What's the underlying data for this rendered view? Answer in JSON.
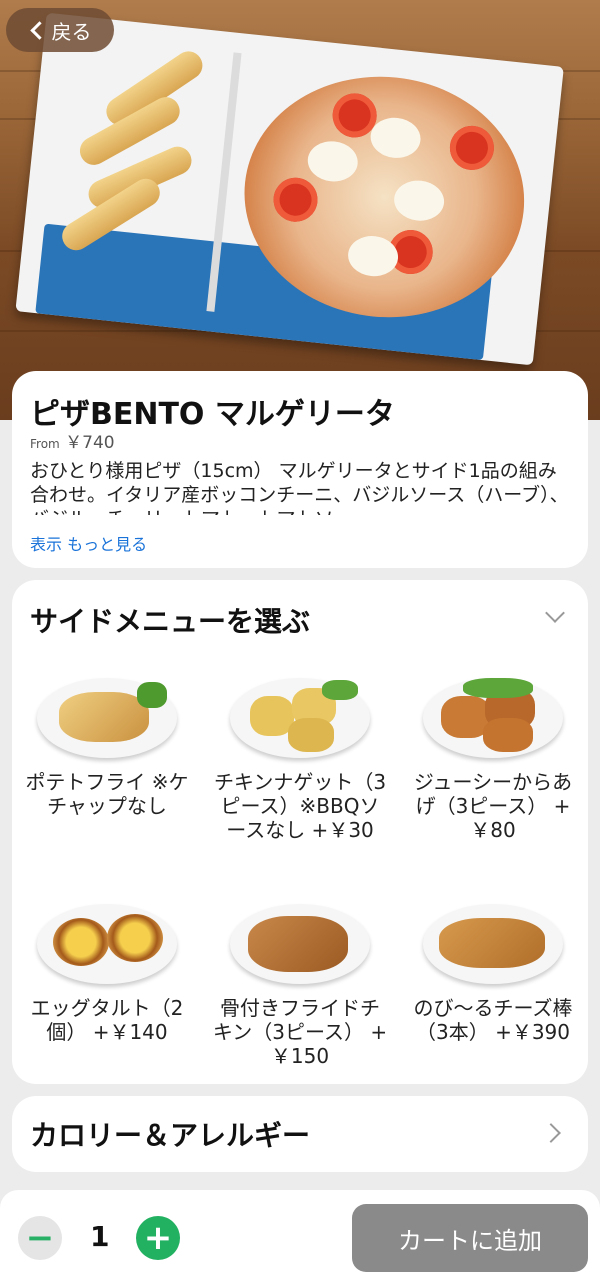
{
  "nav": {
    "back_label": "戻る"
  },
  "product": {
    "title": "ピザBENTO マルゲリータ",
    "price_prefix": "From",
    "price": "￥740",
    "description": "おひとり様用ピザ（15cm） マルゲリータとサイド1品の組み合わせ。イタリア産ボッコンチーニ、バジルソース（ハーブ）、バジル、チェリートマト、トマトソ",
    "show_more": "表示 もっと見る"
  },
  "side_menu": {
    "title": "サイドメニューを選ぶ",
    "items": [
      {
        "label": "ポテトフライ ※ケチャップなし",
        "icon": "potato-wedges"
      },
      {
        "label": "チキンナゲット（3ピース）※BBQソースなし +￥30",
        "icon": "chicken-nuggets"
      },
      {
        "label": "ジューシーからあげ（3ピース） +￥80",
        "icon": "karaage"
      },
      {
        "label": "エッグタルト（2個） +￥140",
        "icon": "egg-tart"
      },
      {
        "label": "骨付きフライドチキン（3ピース） +￥150",
        "icon": "fried-chicken"
      },
      {
        "label": "のび〜るチーズ棒（3本） +￥390",
        "icon": "cheese-sticks"
      }
    ]
  },
  "allergy": {
    "title": "カロリー＆アレルギー"
  },
  "cart": {
    "quantity": "1",
    "minus": "−",
    "plus": "+",
    "add_label": "カートに追加",
    "accent": "#22b061"
  }
}
